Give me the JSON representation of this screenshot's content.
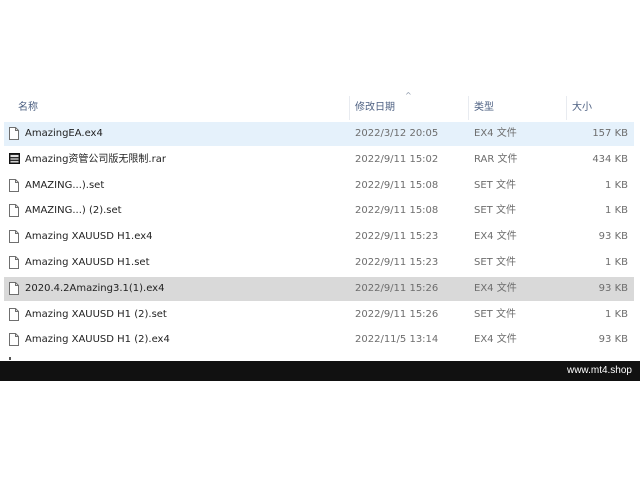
{
  "columns": {
    "name": "名称",
    "date": "修改日期",
    "type": "类型",
    "size": "大小"
  },
  "sort_indicator": "^",
  "files": [
    {
      "name": "AmazingEA.ex4",
      "date": "2022/3/12 20:05",
      "type": "EX4 文件",
      "size": "157 KB",
      "icon": "file-icon",
      "state": "selected"
    },
    {
      "name": "Amazing资管公司版无限制.rar",
      "date": "2022/9/11 15:02",
      "type": "RAR 文件",
      "size": "434 KB",
      "icon": "archive-icon",
      "state": ""
    },
    {
      "name": "AMAZING...).set",
      "date": "2022/9/11 15:08",
      "type": "SET 文件",
      "size": "1 KB",
      "icon": "file-icon",
      "state": ""
    },
    {
      "name": "AMAZING...) (2).set",
      "date": "2022/9/11 15:08",
      "type": "SET 文件",
      "size": "1 KB",
      "icon": "file-icon",
      "state": ""
    },
    {
      "name": "Amazing XAUUSD H1.ex4",
      "date": "2022/9/11 15:23",
      "type": "EX4 文件",
      "size": "93 KB",
      "icon": "file-icon",
      "state": ""
    },
    {
      "name": "Amazing XAUUSD H1.set",
      "date": "2022/9/11 15:23",
      "type": "SET 文件",
      "size": "1 KB",
      "icon": "file-icon",
      "state": ""
    },
    {
      "name": "2020.4.2Amazing3.1(1).ex4",
      "date": "2022/9/11 15:26",
      "type": "EX4 文件",
      "size": "93 KB",
      "icon": "file-icon",
      "state": "hover"
    },
    {
      "name": "Amazing XAUUSD H1 (2).set",
      "date": "2022/9/11 15:26",
      "type": "SET 文件",
      "size": "1 KB",
      "icon": "file-icon",
      "state": ""
    },
    {
      "name": "Amazing XAUUSD H1 (2).ex4",
      "date": "2022/11/5 13:14",
      "type": "EX4 文件",
      "size": "93 KB",
      "icon": "file-icon",
      "state": ""
    }
  ],
  "watermark": "www.mt4.shop"
}
